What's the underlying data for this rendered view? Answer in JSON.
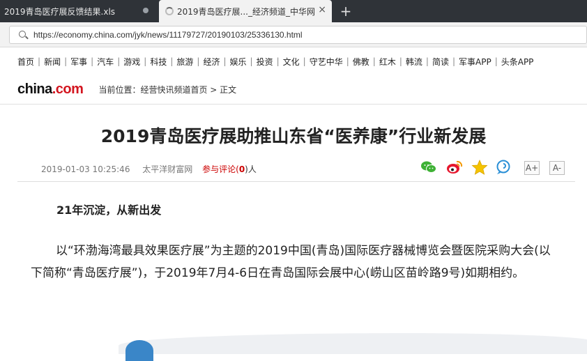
{
  "browser": {
    "tabs": [
      {
        "title": "2019青岛医疗展反馈结果.xls",
        "active": false
      },
      {
        "title": "2019青岛医疗展..._经济频道_中华网",
        "active": true
      }
    ],
    "new_tab": "+",
    "close": "×",
    "url": "https://economy.china.com/jyk/news/11179727/20190103/25336130.html"
  },
  "nav": {
    "items": [
      "首页",
      "新闻",
      "军事",
      "汽车",
      "游戏",
      "科技",
      "旅游",
      "经济",
      "娱乐",
      "投资",
      "文化",
      "守艺中华",
      "佛教",
      "红木",
      "韩流",
      "简读",
      "军事APP",
      "头条APP"
    ],
    "separator": "|"
  },
  "header": {
    "logo_main": "china",
    "logo_accent": ".com",
    "breadcrumb": "当前位置：经营快讯频道首页 > 正文"
  },
  "article": {
    "title": "2019青岛医疗展助推山东省“医养康”行业新发展",
    "date": "2019-01-03 10:25:46",
    "source": "太平洋财富网",
    "comment_prefix": "参与评论(",
    "comment_count": "0",
    "comment_suffix": ")人",
    "font_larger": "A+",
    "font_smaller": "A-",
    "subheading": "21年沉淀，从新出发",
    "paragraph": "以“环渤海湾最具效果医疗展”为主题的2019中国(青岛)国际医疗器械博览会暨医院采购大会(以下简称“青岛医疗展”)，于2019年7月4-6日在青岛国际会展中心(崂山区苗岭路9号)如期相约。"
  },
  "share_icons": [
    "wechat-icon",
    "weibo-icon",
    "star-icon",
    "comment-bubble-icon"
  ],
  "colors": {
    "accent_red": "#d3151f",
    "tab_bar": "#2f3338"
  }
}
